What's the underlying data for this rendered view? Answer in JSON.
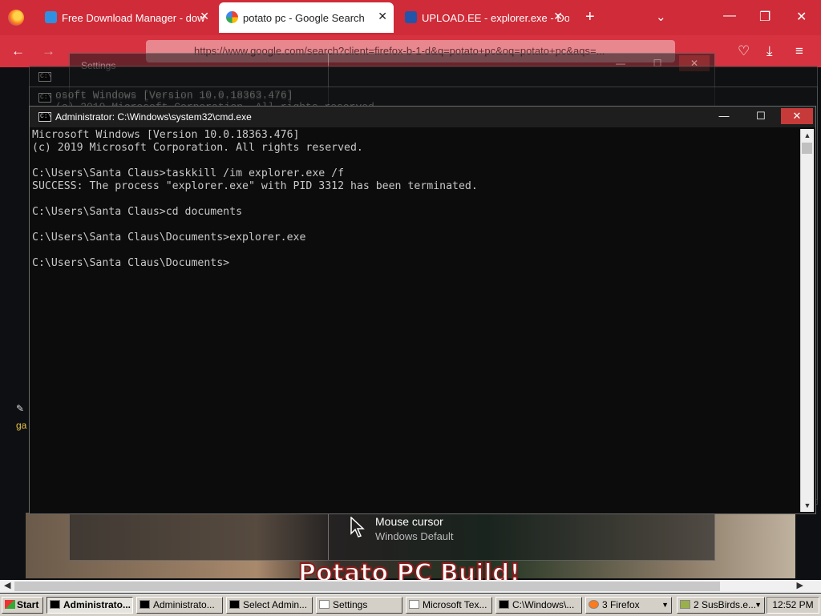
{
  "browser": {
    "tabs": [
      {
        "label": "Free Download Manager - dow",
        "close": "✕",
        "active": false
      },
      {
        "label": "potato pc - Google Search",
        "close": "✕",
        "active": true
      },
      {
        "label": "UPLOAD.EE - explorer.exe - Dov",
        "close": "✕",
        "active": false
      }
    ],
    "new_tab": "+",
    "tab_list": "⌄",
    "url": "https://www.google.com/search?client=firefox-b-1-d&q=potato+pc&oq=potato+pc&aqs=...",
    "window_controls": {
      "minimize": "—",
      "restore": "❐",
      "close": "✕"
    }
  },
  "settings_window": {
    "title": "Settings",
    "item": {
      "title": "Mouse cursor",
      "subtitle": "Windows Default"
    }
  },
  "ghost_windows": [
    {
      "lines": "osoft Windows [Version 10.0.18363.476]"
    },
    {
      "lines": "osoft Windows [Version 10.0.18363.476]\n(c) 2019 Microsoft Corporation. All rights reserved."
    }
  ],
  "cmd": {
    "title": "Administrator: C:\\Windows\\system32\\cmd.exe",
    "lines": [
      "Microsoft Windows [Version 10.0.18363.476]",
      "(c) 2019 Microsoft Corporation. All rights reserved.",
      "",
      "C:\\Users\\Santa Claus>taskkill /im explorer.exe /f",
      "SUCCESS: The process \"explorer.exe\" with PID 3312 has been terminated.",
      "",
      "C:\\Users\\Santa Claus>cd documents",
      "",
      "C:\\Users\\Santa Claus\\Documents>explorer.exe",
      "",
      "C:\\Users\\Santa Claus\\Documents>"
    ]
  },
  "page": {
    "video_title": "Potato PC Build!",
    "side_label": "ga"
  },
  "taskbar": {
    "start": "Start",
    "buttons": [
      {
        "label": "Administrato...",
        "pressed": true
      },
      {
        "label": "Administrato...",
        "pressed": false
      },
      {
        "label": "Select Admin...",
        "pressed": false
      },
      {
        "label": "Settings",
        "pressed": false
      },
      {
        "label": "Microsoft Tex...",
        "pressed": false
      },
      {
        "label": "C:\\Windows\\...",
        "pressed": false
      },
      {
        "label": "3 Firefox",
        "pressed": false
      },
      {
        "label": "2 SusBirds.e...",
        "pressed": false
      }
    ],
    "clock": "12:52 PM"
  },
  "colors": {
    "firefox_red": "#cf2b38",
    "close_red": "#c73a3a",
    "taskbar": "#d4d0c8"
  }
}
